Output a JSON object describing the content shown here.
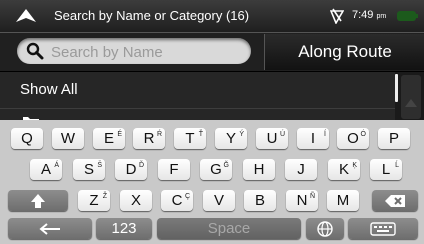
{
  "header": {
    "title": "Search by Name or Category (16)",
    "time": "7:49",
    "time_suffix": "pm",
    "icons": [
      "up-arrow-icon",
      "gps-icon",
      "battery-icon"
    ]
  },
  "search": {
    "placeholder": "Search by Name",
    "value": ""
  },
  "along_route_label": "Along Route",
  "list": {
    "items": [
      {
        "label": "Show All"
      }
    ]
  },
  "keyboard": {
    "row1": [
      {
        "k": "Q",
        "alt": ""
      },
      {
        "k": "W",
        "alt": ""
      },
      {
        "k": "E",
        "alt": "É"
      },
      {
        "k": "R",
        "alt": "Ŕ"
      },
      {
        "k": "T",
        "alt": "Ť"
      },
      {
        "k": "Y",
        "alt": "Ý"
      },
      {
        "k": "U",
        "alt": "Ú"
      },
      {
        "k": "I",
        "alt": "Í"
      },
      {
        "k": "O",
        "alt": "Ó"
      },
      {
        "k": "P",
        "alt": ""
      }
    ],
    "row2": [
      {
        "k": "A",
        "alt": "Á"
      },
      {
        "k": "S",
        "alt": "Š"
      },
      {
        "k": "D",
        "alt": "Ď"
      },
      {
        "k": "F",
        "alt": ""
      },
      {
        "k": "G",
        "alt": "Ğ"
      },
      {
        "k": "H",
        "alt": ""
      },
      {
        "k": "J",
        "alt": ""
      },
      {
        "k": "K",
        "alt": "Ķ"
      },
      {
        "k": "L",
        "alt": "Ĺ"
      }
    ],
    "row3": [
      {
        "k": "Z",
        "alt": "Ž"
      },
      {
        "k": "X",
        "alt": ""
      },
      {
        "k": "C",
        "alt": "Ç"
      },
      {
        "k": "V",
        "alt": ""
      },
      {
        "k": "B",
        "alt": ""
      },
      {
        "k": "N",
        "alt": "Ñ"
      },
      {
        "k": "M",
        "alt": ""
      }
    ],
    "numbers_label": "123",
    "space_label": "Space",
    "icons": [
      "back-arrow-icon",
      "shift-icon",
      "backspace-icon",
      "globe-icon",
      "keyboard-icon"
    ]
  }
}
